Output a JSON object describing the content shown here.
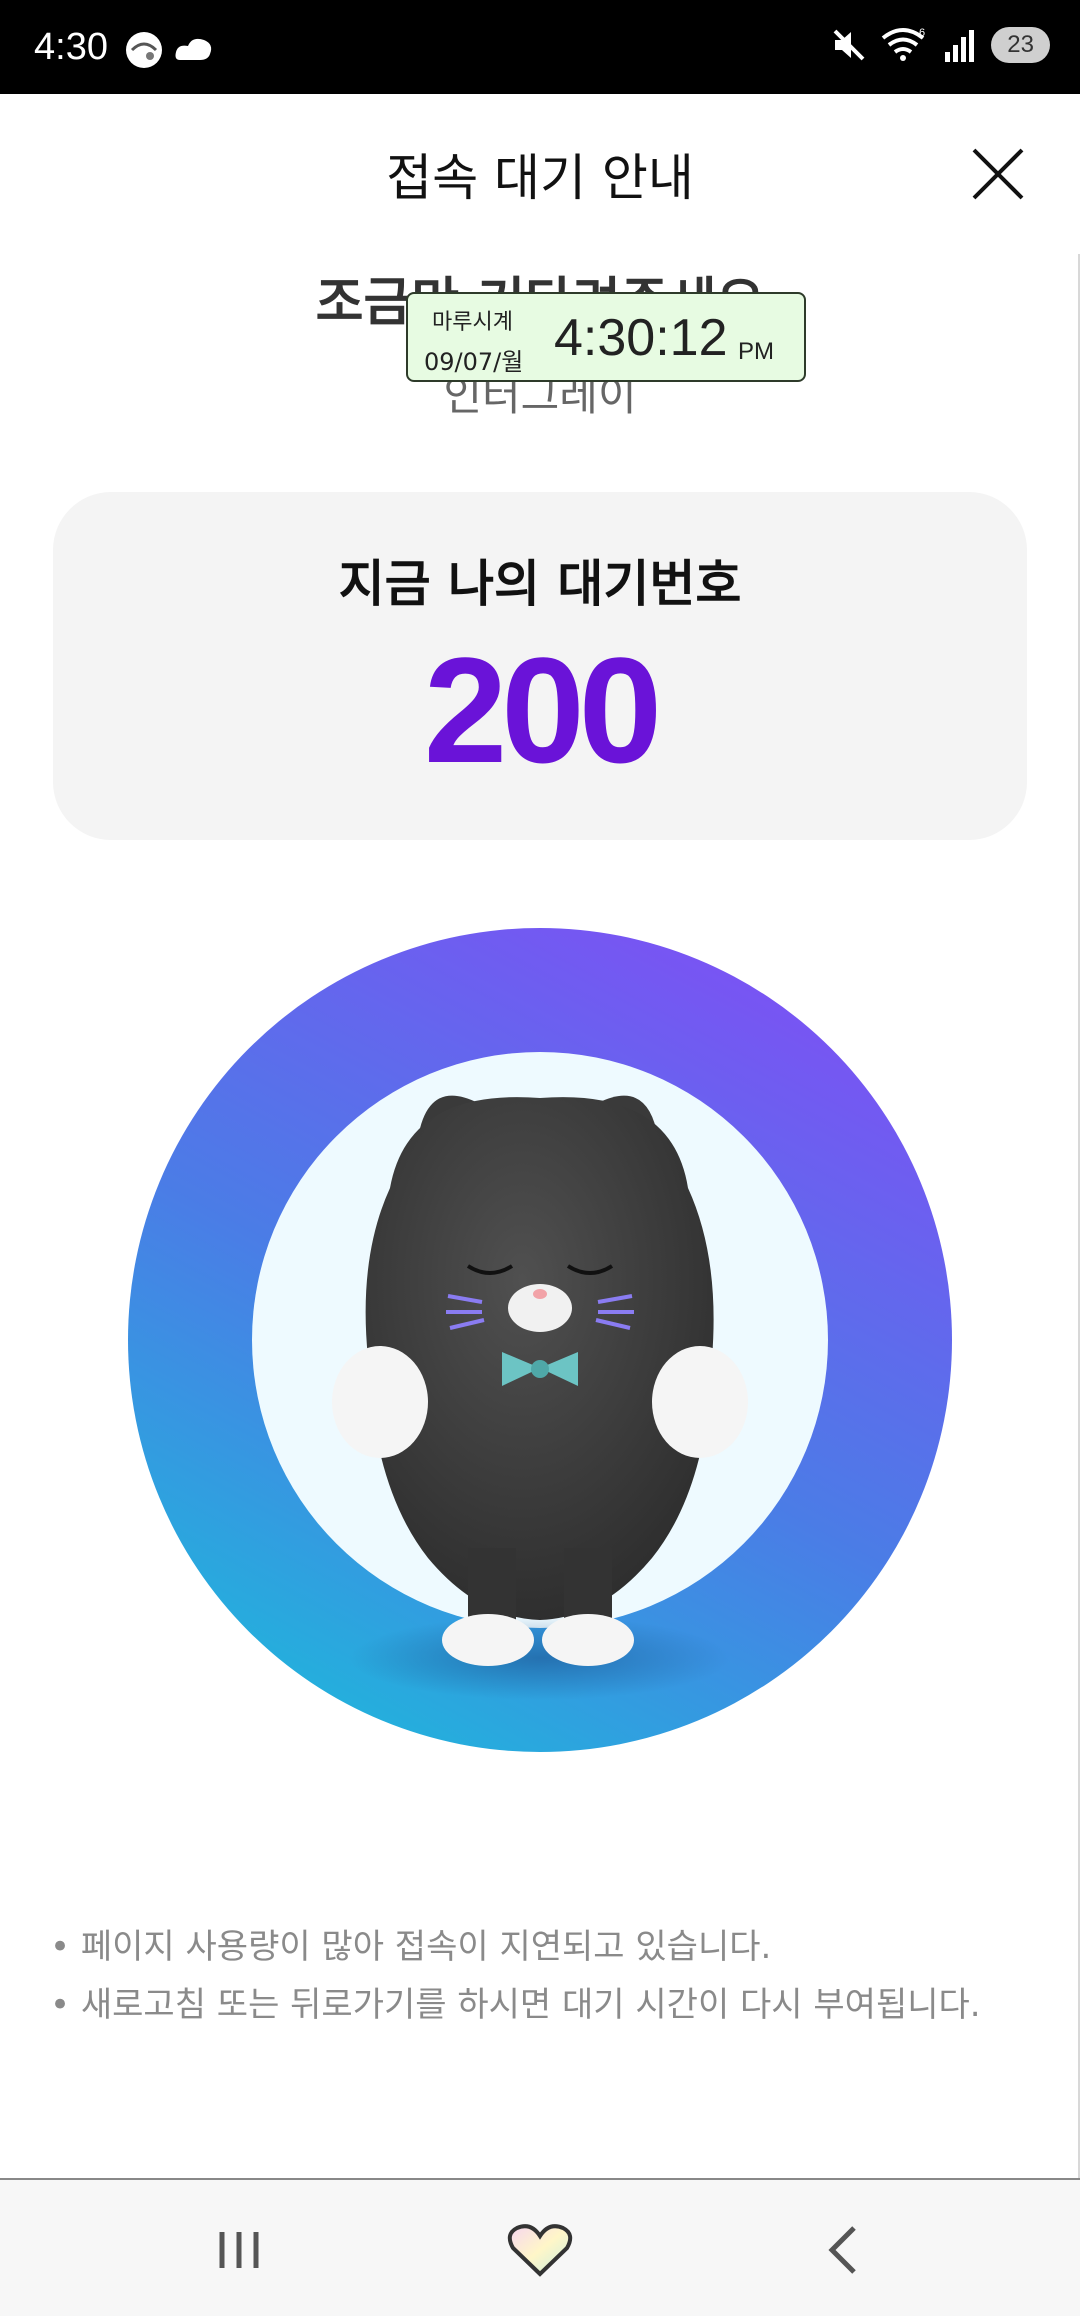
{
  "status_bar": {
    "time": "4:30",
    "battery": "23",
    "icons": [
      "weather-icon",
      "cloud-icon",
      "mute-icon",
      "wifi-icon",
      "signal-icon",
      "battery-icon"
    ]
  },
  "header": {
    "title": "접속 대기 안내",
    "close_icon": "close-icon"
  },
  "main": {
    "headline": "조금만 기다려주세요",
    "subline": "인터그레이"
  },
  "clock_widget": {
    "app_name": "마루시계",
    "date": "09/07/월",
    "time": "4:30:12",
    "ampm": "PM"
  },
  "queue": {
    "label": "지금 나의 대기번호",
    "number": "200"
  },
  "notes": [
    "• 페이지 사용량이 많아 접속이 지연되고 있습니다.",
    "• 새로고침 또는 뒤로가기를 하시면 대기 시간이 다시 부여됩니다."
  ],
  "nav": {
    "icons": [
      "recents-icon",
      "home-heart-icon",
      "back-icon"
    ]
  },
  "colors": {
    "accent": "#6a13d8",
    "ring_top": "#7b52f4",
    "ring_bottom": "#22b2dc",
    "inner": "#eefaff"
  }
}
